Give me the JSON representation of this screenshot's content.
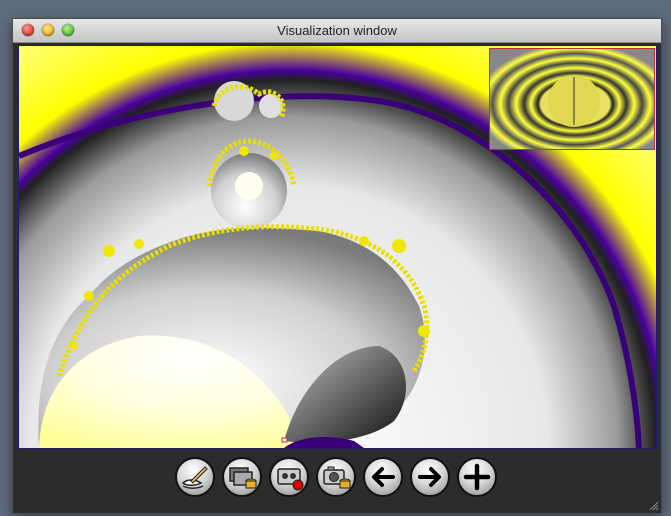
{
  "window": {
    "title": "Visualization window"
  },
  "toolbar": {
    "buttons": [
      {
        "icon": "edit-palette-icon"
      },
      {
        "icon": "save-images-icon"
      },
      {
        "icon": "record-video-icon"
      },
      {
        "icon": "save-snapshot-icon"
      },
      {
        "icon": "back-arrow-icon"
      },
      {
        "icon": "forward-arrow-icon"
      },
      {
        "icon": "zoom-in-icon"
      }
    ]
  },
  "colors": {
    "fractal_yellow": "#ffff00",
    "fractal_purple": "#3a007a",
    "toolbar_bg": "#2c2c2c",
    "inset_border": "#c03030"
  }
}
